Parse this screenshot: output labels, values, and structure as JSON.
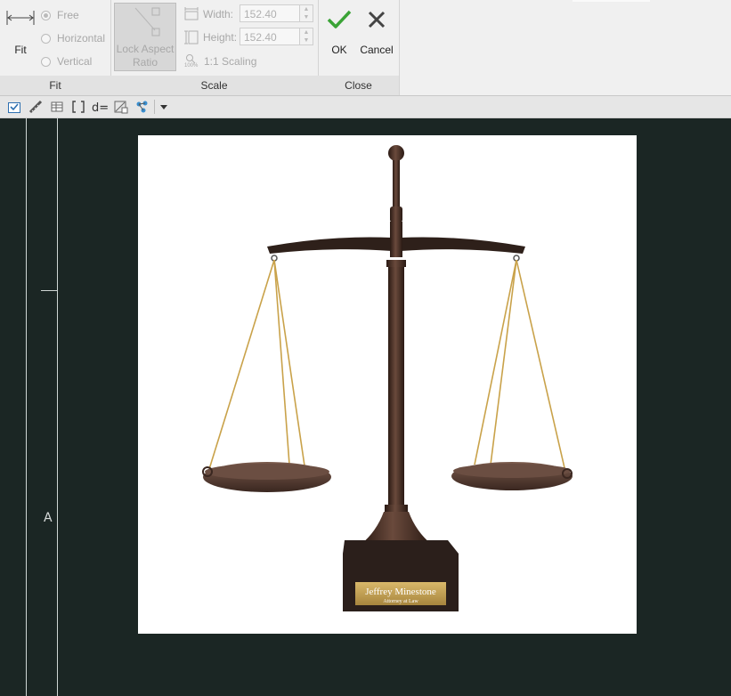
{
  "ribbon": {
    "fit_group": {
      "label": "Fit",
      "fit_button": "Fit",
      "options": [
        {
          "label": "Free",
          "selected": true
        },
        {
          "label": "Horizontal",
          "selected": false
        },
        {
          "label": "Vertical",
          "selected": false
        }
      ]
    },
    "scale_group": {
      "label": "Scale",
      "lock_aspect_ratio": "Lock Aspect Ratio",
      "width_label": "Width:",
      "width_value": "152.40",
      "height_label": "Height:",
      "height_value": "152.40",
      "scaling_label": "1:1 Scaling",
      "scaling_icon_text": "100%"
    },
    "close_group": {
      "label": "Close",
      "ok": "OK",
      "cancel": "Cancel"
    }
  },
  "canvas": {
    "marker_label": "A",
    "image": {
      "description_icon": "scales-of-justice-image",
      "plaque_name": "Jeffrey Minestone",
      "plaque_title": "Attorney at Law"
    }
  },
  "colors": {
    "canvas_bg": "#1b2624",
    "ribbon_bg": "#f0f0f0",
    "ok_green": "#3aa336",
    "disabled_text": "#a8a8a8"
  }
}
